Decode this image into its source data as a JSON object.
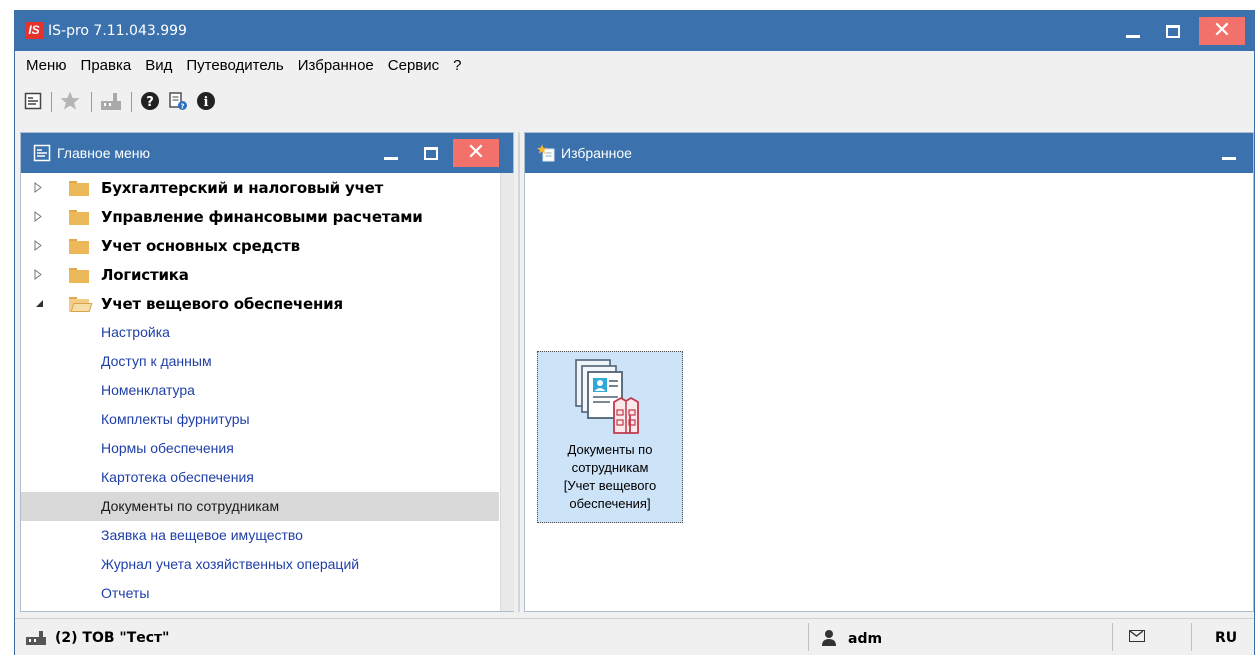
{
  "app": {
    "logo": "IS",
    "title": "IS-pro 7.11.043.999"
  },
  "window_controls": {
    "minimize_icon": "minimize-icon",
    "maximize_icon": "maximize-icon",
    "close_icon": "close-icon",
    "close_color": "#f3716b"
  },
  "menu": [
    "Меню",
    "Правка",
    "Вид",
    "Путеводитель",
    "Избранное",
    "Сервис",
    "?"
  ],
  "toolbar": {
    "icons": [
      "main-menu-icon",
      "favorites-star-icon",
      "organization-icon",
      "help-icon",
      "documents-help-icon",
      "info-icon"
    ]
  },
  "left_panel": {
    "title": "Главное меню",
    "groups": [
      {
        "label": "Бухгалтерский и налоговый учет",
        "expanded": false
      },
      {
        "label": "Управление финансовыми расчетами",
        "expanded": false
      },
      {
        "label": "Учет основных средств",
        "expanded": false
      },
      {
        "label": "Логистика",
        "expanded": false
      },
      {
        "label": "Учет вещевого обеспечения",
        "expanded": true
      }
    ],
    "items": [
      {
        "label": "Настройка",
        "selected": false
      },
      {
        "label": "Доступ к данным",
        "selected": false
      },
      {
        "label": "Номенклатура",
        "selected": false
      },
      {
        "label": "Комплекты фурнитуры",
        "selected": false
      },
      {
        "label": "Нормы обеспечения",
        "selected": false
      },
      {
        "label": "Картотека обеспечения",
        "selected": false
      },
      {
        "label": "Документы по сотрудникам",
        "selected": true
      },
      {
        "label": "Заявка на вещевое имущество",
        "selected": false
      },
      {
        "label": "Журнал учета хозяйственных операций",
        "selected": false
      },
      {
        "label": "Отчеты",
        "selected": false
      }
    ]
  },
  "right_panel": {
    "title": "Избранное",
    "favorite": {
      "label_lines": [
        "Документы по",
        "сотрудникам",
        "[Учет вещевого",
        "обеспечения]"
      ],
      "icon": "employee-documents-clothing-icon"
    }
  },
  "status": {
    "org": "(2) ТОВ \"Тест\"",
    "user": "adm",
    "lang": "RU",
    "mail_icon": "mail-icon"
  },
  "colors": {
    "header_blue": "#3b71ad",
    "link_blue": "#1f3fa8",
    "selection": "#d9d9d9",
    "tile_bg": "#cde3f8"
  }
}
